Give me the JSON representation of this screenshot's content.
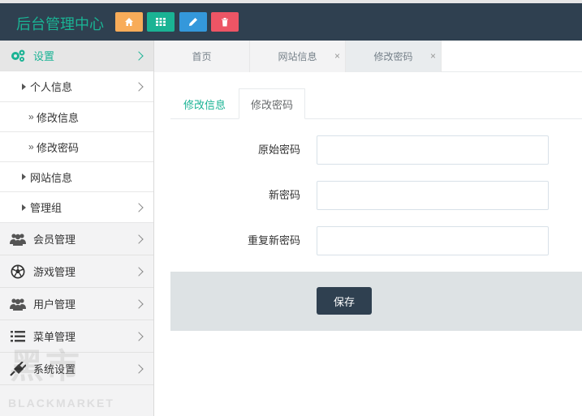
{
  "header": {
    "title": "后台管理中心",
    "buttons": [
      {
        "icon": "home-icon",
        "color": "#f8ac59"
      },
      {
        "icon": "grid-icon",
        "color": "#1ab394"
      },
      {
        "icon": "pencil-icon",
        "color": "#3498db"
      },
      {
        "icon": "trash-icon",
        "color": "#ed5565"
      }
    ]
  },
  "sidebar": {
    "settings": {
      "label": "设置",
      "icon": "gears-icon"
    },
    "sub": {
      "personal_info": "个人信息",
      "edit_info": "修改信息",
      "change_password": "修改密码",
      "site_info": "网站信息",
      "admin_group": "管理组"
    },
    "groups": [
      {
        "label": "会员管理",
        "icon": "users-icon"
      },
      {
        "label": "游戏管理",
        "icon": "soccer-ball-icon"
      },
      {
        "label": "用户管理",
        "icon": "users-icon"
      },
      {
        "label": "菜单管理",
        "icon": "list-icon"
      },
      {
        "label": "系统设置",
        "icon": "plug-icon"
      }
    ],
    "quote_mark": "»",
    "watermark": {
      "big": "黑市",
      "small": "BLACKMARKET"
    }
  },
  "page_tabs": [
    {
      "label": "首页"
    },
    {
      "label": "网站信息",
      "close": "×"
    },
    {
      "label": "修改密码",
      "close": "×"
    }
  ],
  "inner_tabs": [
    "修改信息",
    "修改密码"
  ],
  "form": {
    "original_password": "原始密码",
    "new_password": "新密码",
    "repeat_password": "重复新密码",
    "save": "保存"
  },
  "colors": {
    "accent": "#1ab394",
    "dark": "#2f4050"
  }
}
